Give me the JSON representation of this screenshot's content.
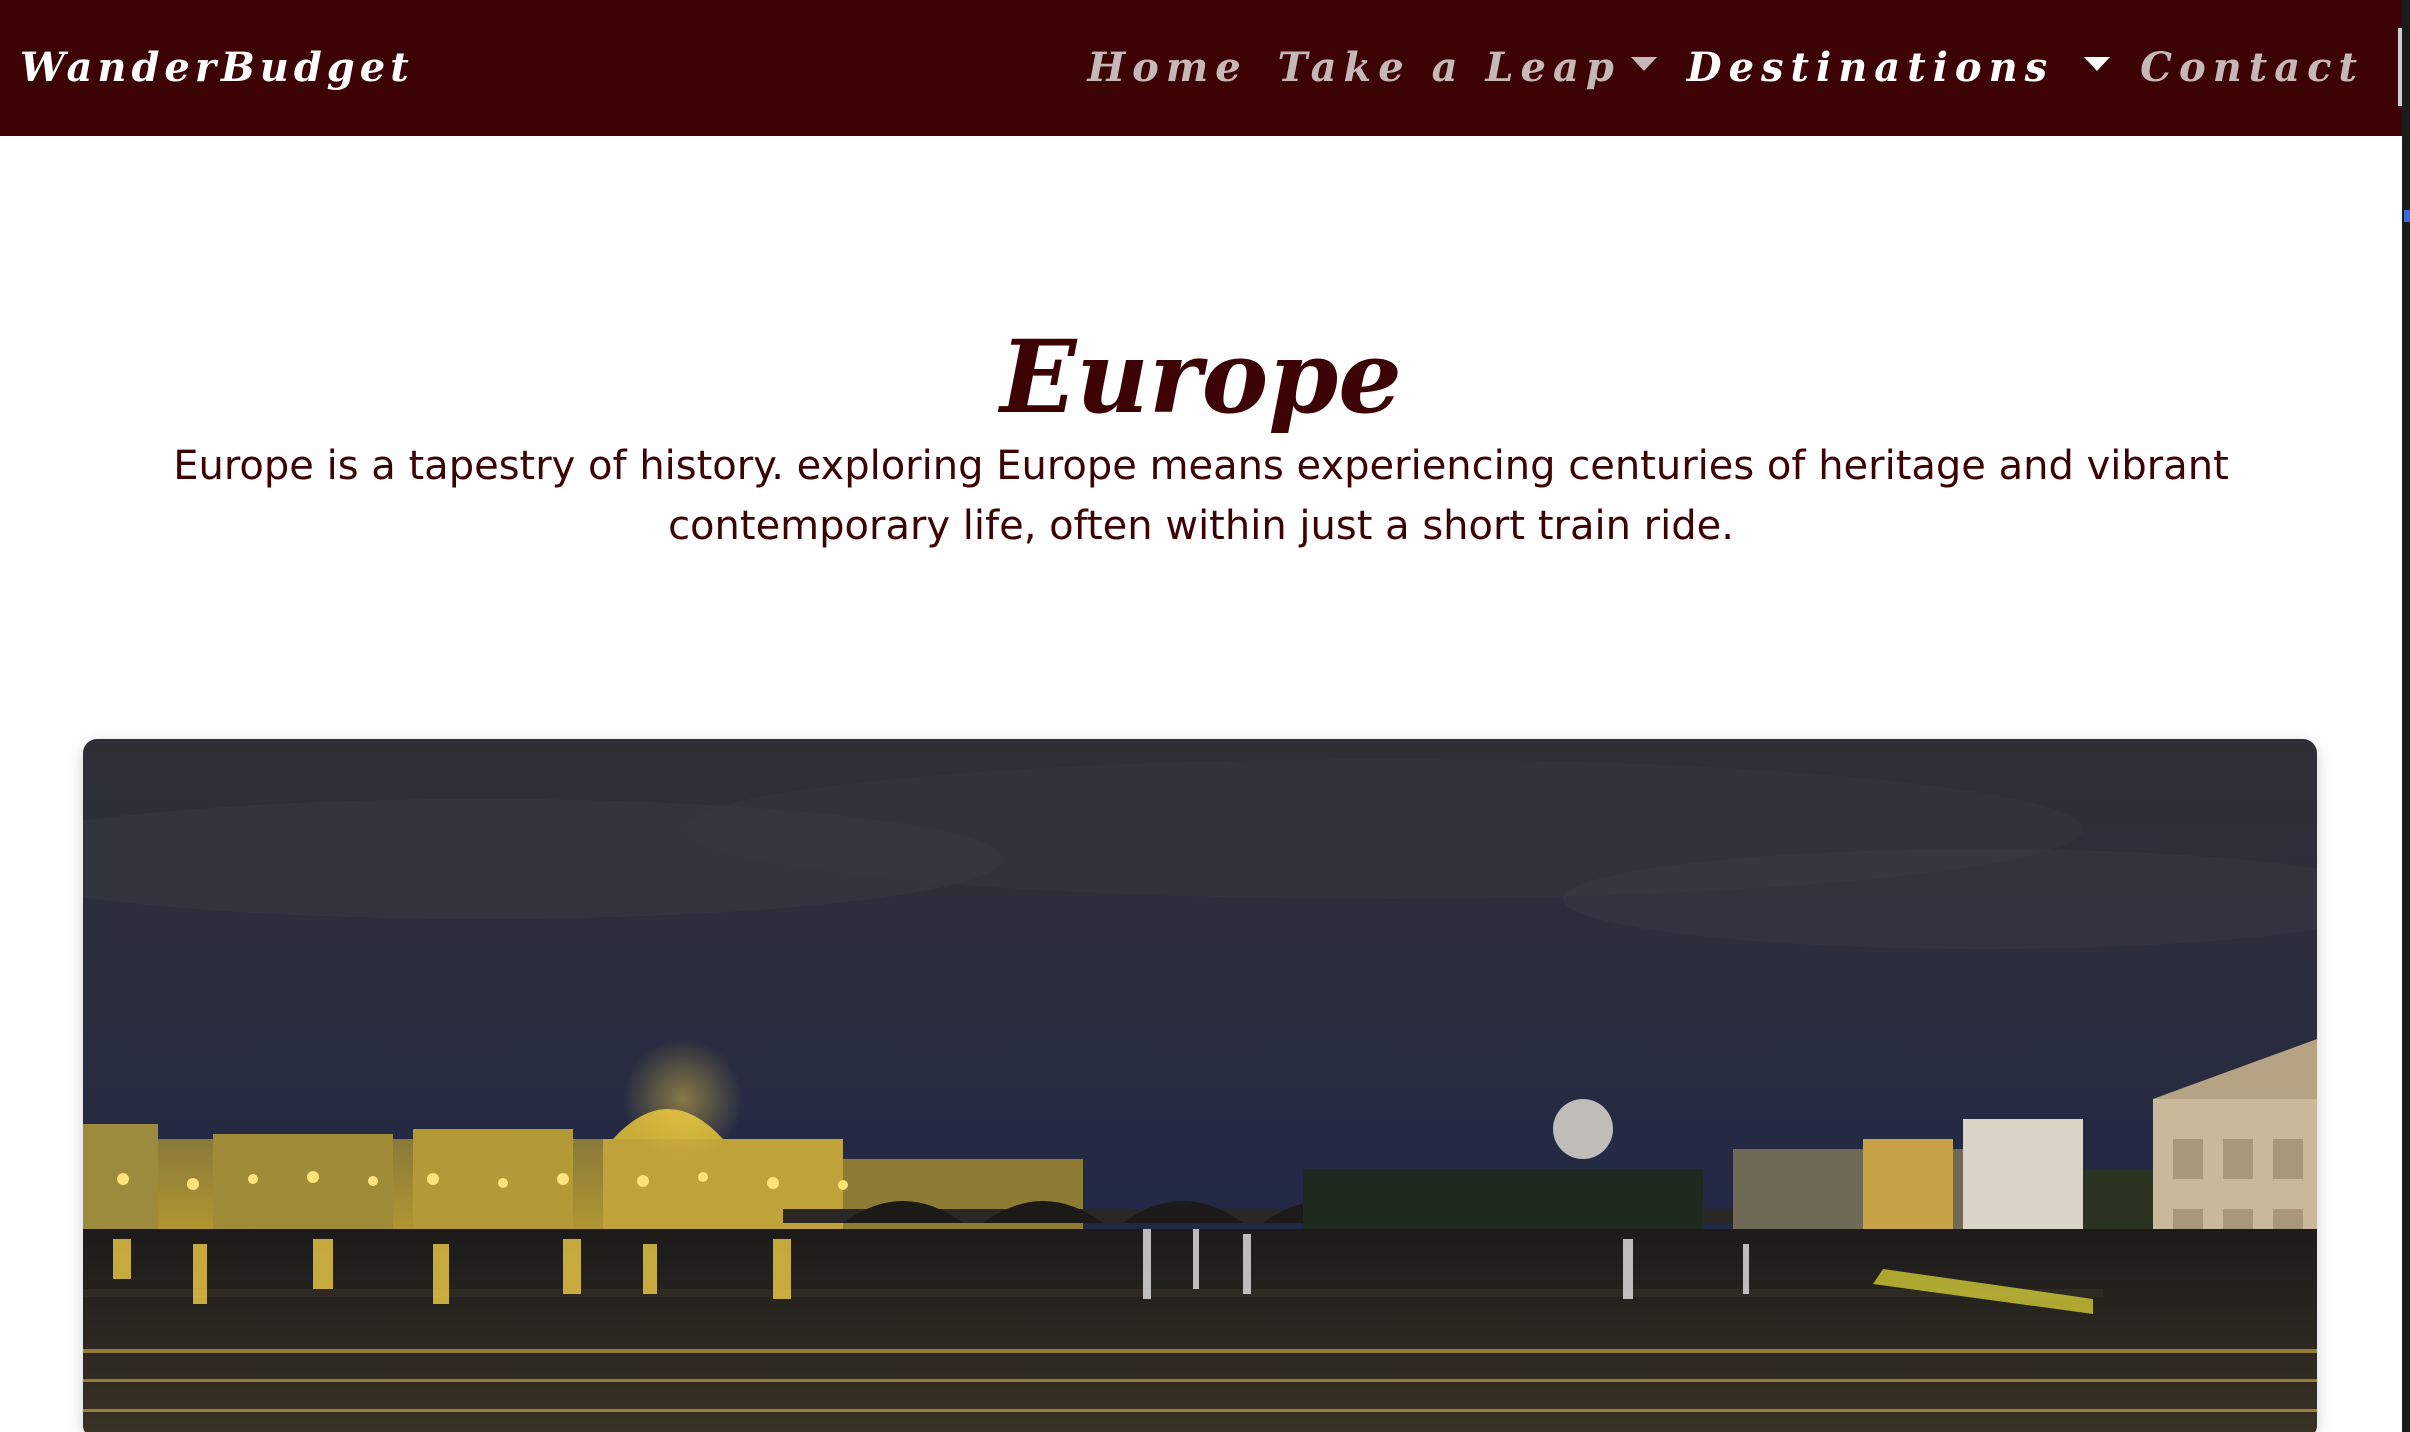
{
  "navbar": {
    "brand": "WanderBudget",
    "items": [
      {
        "label": "Home",
        "dropdown": false,
        "active": false
      },
      {
        "label": "Take a Leap",
        "dropdown": true,
        "active": false
      },
      {
        "label": "Destinations",
        "dropdown": true,
        "active": true
      },
      {
        "label": "Contact",
        "dropdown": false,
        "active": false
      }
    ]
  },
  "main": {
    "title": "Europe",
    "intro": "Europe is a tapestry of history. exploring Europe means experiencing centuries of heritage and vibrant contemporary life, often within just a short train ride."
  },
  "colors": {
    "navbar_bg": "#3d0204",
    "accent_text": "#3d0204",
    "nav_inactive": "#c7b8b8",
    "nav_active": "#ffffff"
  },
  "icons": {
    "dropdown": "caret-down-icon"
  }
}
